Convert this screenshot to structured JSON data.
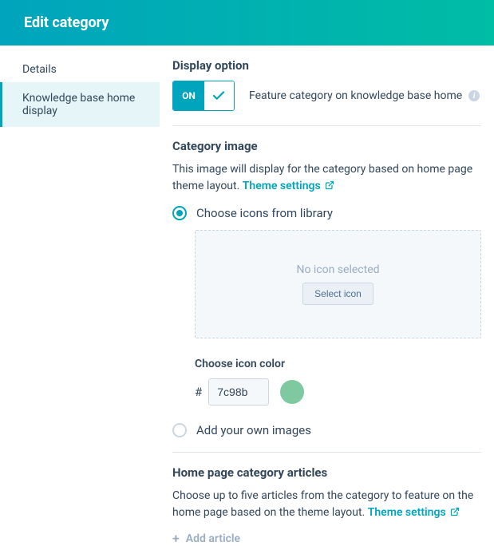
{
  "header": {
    "title": "Edit category"
  },
  "sidebar": {
    "items": [
      {
        "label": "Details",
        "active": false
      },
      {
        "label": "Knowledge base home display",
        "active": true
      }
    ]
  },
  "display_option": {
    "heading": "Display option",
    "toggle_label": "ON",
    "toggle_state": "on",
    "feature_label": "Feature category on knowledge base home"
  },
  "category_image": {
    "heading": "Category image",
    "description": "This image will display for the category based on home page theme layout.",
    "link_label": "Theme settings",
    "radio_library_label": "Choose icons from library",
    "no_icon_text": "No icon selected",
    "select_icon_label": "Select icon",
    "color_label": "Choose icon color",
    "hash": "#",
    "hex_value": "7c98b",
    "swatch_color": "#7fc9a0",
    "radio_own_label": "Add your own images"
  },
  "articles": {
    "heading": "Home page category articles",
    "description": "Choose up to five articles from the category to feature on the home page based on the theme layout.",
    "link_label": "Theme settings",
    "add_label": "Add article"
  }
}
